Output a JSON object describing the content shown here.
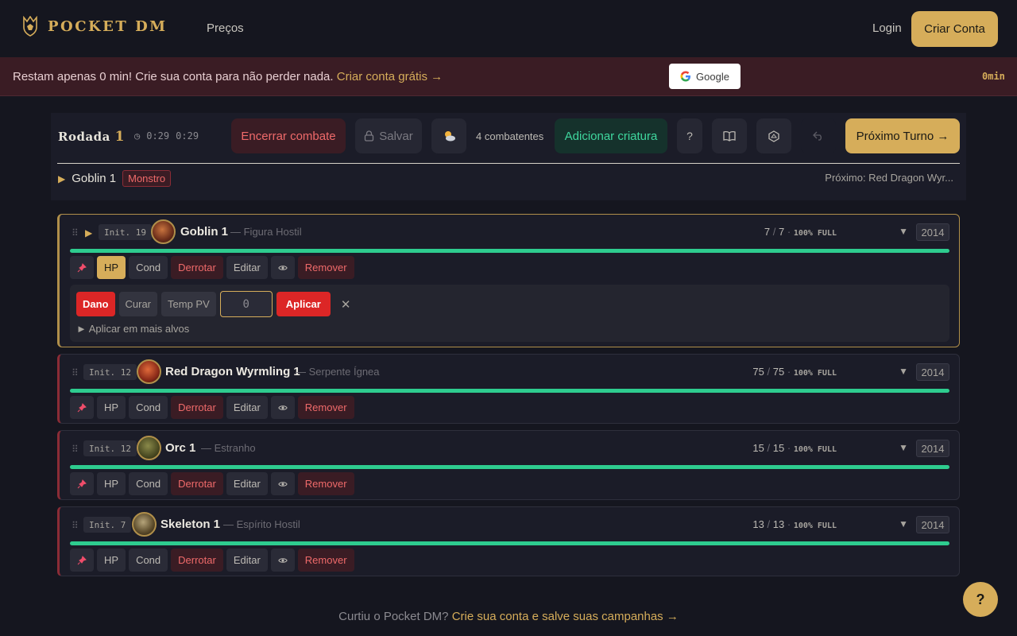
{
  "header": {
    "logo_text": "POCKET DM",
    "nav_pricing": "Preços",
    "login": "Login",
    "signup": "Criar Conta"
  },
  "banner": {
    "message": "Restam apenas 0 min! Crie sua conta para não perder nada.",
    "link": "Criar conta grátis →",
    "google_label": "Google",
    "timer": "0min"
  },
  "combat": {
    "round_label": "Rodada",
    "round_number": "1",
    "clock_a": "0:29",
    "clock_b": "0:29",
    "end_button": "Encerrar combate",
    "save_button": "Salvar",
    "combatant_count": "4 combatentes",
    "add_button": "Adicionar criatura",
    "help_button": "?",
    "next_button": "Próximo Turno →",
    "current_name": "Goblin 1",
    "current_badge": "Monstro",
    "next_label": "Próximo: Red Dragon Wyr..."
  },
  "labels": {
    "init_prefix": "Init.",
    "full": "100% FULL",
    "hp": "HP",
    "cond": "Cond",
    "defeat": "Derrotar",
    "edit": "Editar",
    "remove": "Remover",
    "damage": "Dano",
    "heal": "Curar",
    "temp": "Temp PV",
    "apply": "Aplicar",
    "input_value": "0",
    "more_targets": "► Aplicar em mais alvos"
  },
  "combatants": [
    {
      "init": "Init. 19",
      "name": "Goblin 1",
      "type": "— Figura Hostil",
      "hp_cur": "7",
      "hp_max": "7",
      "edition": "2014"
    },
    {
      "init": "Init. 12",
      "name": "Red Dragon Wyrmling 1",
      "type": "— Serpente Ígnea",
      "hp_cur": "75",
      "hp_max": "75",
      "edition": "2014"
    },
    {
      "init": "Init. 12",
      "name": "Orc 1",
      "type": "— Estranho",
      "hp_cur": "15",
      "hp_max": "15",
      "edition": "2014"
    },
    {
      "init": "Init. 7",
      "name": "Skeleton 1",
      "type": "— Espírito Hostil",
      "hp_cur": "13",
      "hp_max": "13",
      "edition": "2014"
    }
  ],
  "footer": {
    "text": "Curtiu o Pocket DM?",
    "link": "Crie sua conta e salve suas campanhas →"
  },
  "help_fab": "?",
  "colors": {
    "accent": "#d6ad5a",
    "danger": "#ef6a6a",
    "hp_bar": "#2ecc8f",
    "background": "#15161f"
  }
}
